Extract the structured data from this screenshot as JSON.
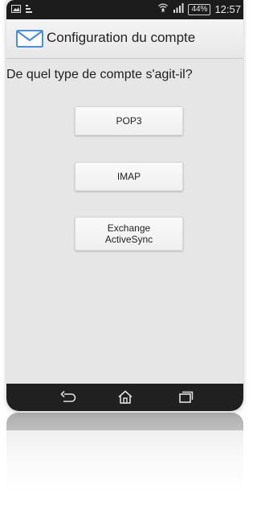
{
  "status_bar": {
    "battery": "44%",
    "time": "12:57"
  },
  "action_bar": {
    "title": "Configuration du compte",
    "icon": "mail-icon",
    "accent": "#4a8fd8"
  },
  "content": {
    "question": "De quel type de compte s'agit-il?",
    "buttons": [
      {
        "label": "POP3"
      },
      {
        "label": "IMAP"
      },
      {
        "label_line1": "Exchange",
        "label_line2": "ActiveSync"
      }
    ]
  },
  "nav_bar": {
    "icons": [
      "back-icon",
      "home-icon",
      "recent-apps-icon"
    ]
  }
}
